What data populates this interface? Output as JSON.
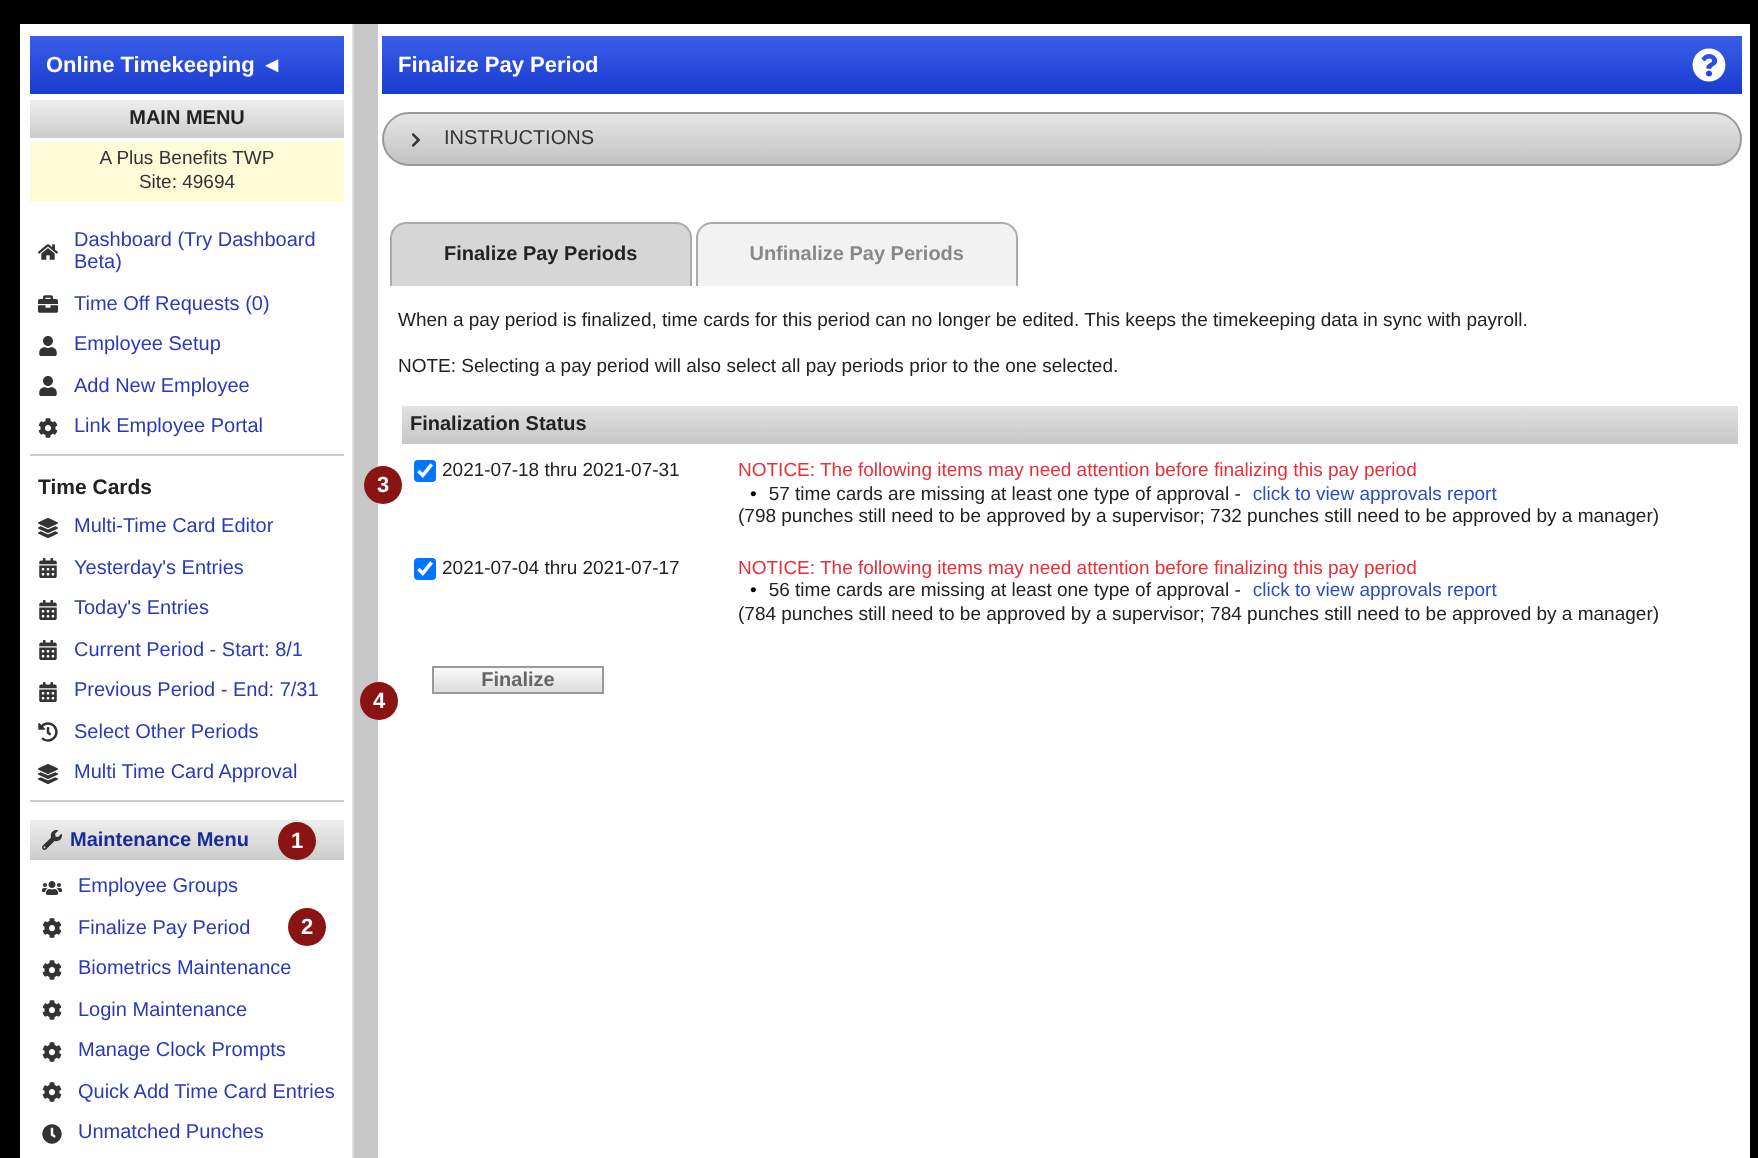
{
  "sidebar": {
    "title": "Online Timekeeping ◄",
    "main_menu": "MAIN MENU",
    "site": [
      "A Plus Benefits TWP",
      "Site: 49694"
    ],
    "groups": [
      {
        "items": [
          {
            "label": "Dashboard (Try Dashboard Beta)"
          },
          {
            "label": "Time Off Requests (0)"
          },
          {
            "label": "Employee Setup"
          },
          {
            "label": "Add New Employee"
          },
          {
            "label": "Link Employee Portal"
          }
        ]
      },
      {
        "heading": "Time Cards",
        "items": [
          {
            "label": "Multi-Time Card Editor"
          },
          {
            "label": "Yesterday's Entries"
          },
          {
            "label": "Today's Entries"
          },
          {
            "label": "Current Period - Start: 8/1"
          },
          {
            "label": "Previous Period - End: 7/31"
          },
          {
            "label": "Select Other Periods"
          },
          {
            "label": "Multi Time Card Approval"
          }
        ]
      }
    ],
    "maintenance": {
      "label": "Maintenance Menu",
      "items": [
        {
          "label": "Employee Groups"
        },
        {
          "label": "Finalize Pay Period"
        },
        {
          "label": "Biometrics Maintenance"
        },
        {
          "label": "Login Maintenance"
        },
        {
          "label": "Manage Clock Prompts"
        },
        {
          "label": "Quick Add Time Card Entries"
        },
        {
          "label": "Unmatched Punches"
        }
      ]
    }
  },
  "page": {
    "title": "Finalize Pay Period",
    "instructions": "INSTRUCTIONS",
    "tabs": [
      {
        "label": "Finalize Pay Periods",
        "selected": true
      },
      {
        "label": "Unfinalize Pay Periods",
        "selected": false
      }
    ],
    "paragraphs": [
      "When a pay period is finalized, time cards for this period can no longer be edited. This keeps the timekeeping data in sync with payroll.",
      "NOTE: Selecting a pay period will also select all pay periods prior to the one selected."
    ],
    "status_heading": "Finalization Status",
    "periods": [
      {
        "label": "2021-07-18 thru 2021-07-31",
        "checked": true,
        "notice": "NOTICE: The following items may need attention before finalizing this pay period",
        "mark": "•",
        "bullet": "57 time cards are missing at least one type of approval -",
        "link": "click to view approvals report",
        "detail": "(798 punches still need to be approved by a supervisor; 732 punches still need to be approved by a manager)"
      },
      {
        "label": "2021-07-04 thru 2021-07-17",
        "checked": true,
        "notice": "NOTICE: The following items may need attention before finalizing this pay period",
        "mark": "•",
        "bullet": "56 time cards are missing at least one type of approval -",
        "link": "click to view approvals report",
        "detail": "(784 punches still need to be approved by a supervisor; 784 punches still need to be approved by a manager)"
      }
    ],
    "finalize_button": "Finalize"
  },
  "callouts": [
    "1",
    "2",
    "3",
    "4"
  ]
}
